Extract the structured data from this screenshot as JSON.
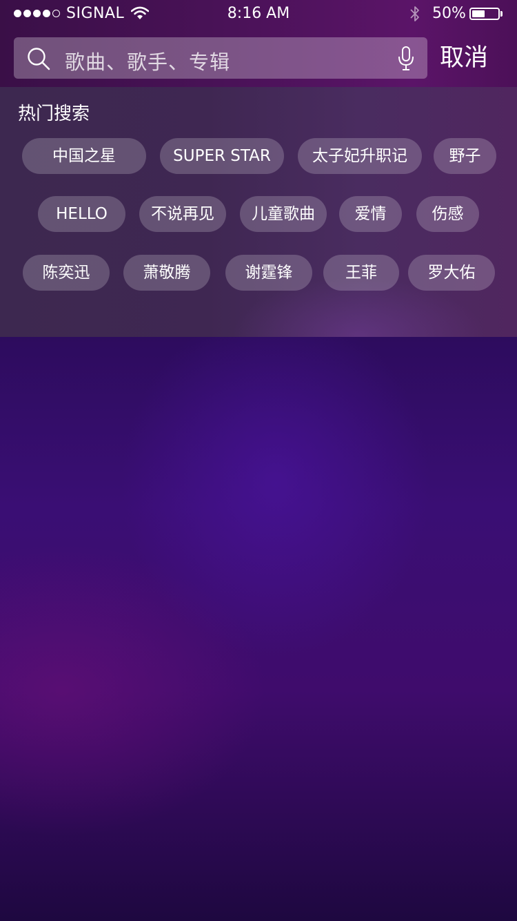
{
  "status_bar": {
    "carrier": "SIGNAL",
    "time": "8:16 AM",
    "battery_percent_text": "50%",
    "battery_level": 0.5,
    "signal_bars": 4,
    "signal_bars_total": 5
  },
  "search": {
    "placeholder": "歌曲、歌手、专辑",
    "cancel_label": "取消"
  },
  "hot_search": {
    "title": "热门搜索",
    "rows": [
      [
        "中国之星",
        "SUPER STAR",
        "太子妃升职记",
        "野子"
      ],
      [
        "HELLO",
        "不说再见",
        "儿童歌曲",
        "爱情",
        "伤感"
      ],
      [
        "陈奕迅",
        "萧敬腾",
        "谢霆锋",
        "王菲",
        "罗大佑"
      ]
    ]
  },
  "colors": {
    "tag_background": "rgba(255,255,255,0.2)",
    "text": "#ffffff",
    "background_purple": "#3a0e74"
  },
  "icons": [
    "wifi-icon",
    "bluetooth-icon",
    "battery-icon",
    "search-icon",
    "microphone-icon"
  ]
}
